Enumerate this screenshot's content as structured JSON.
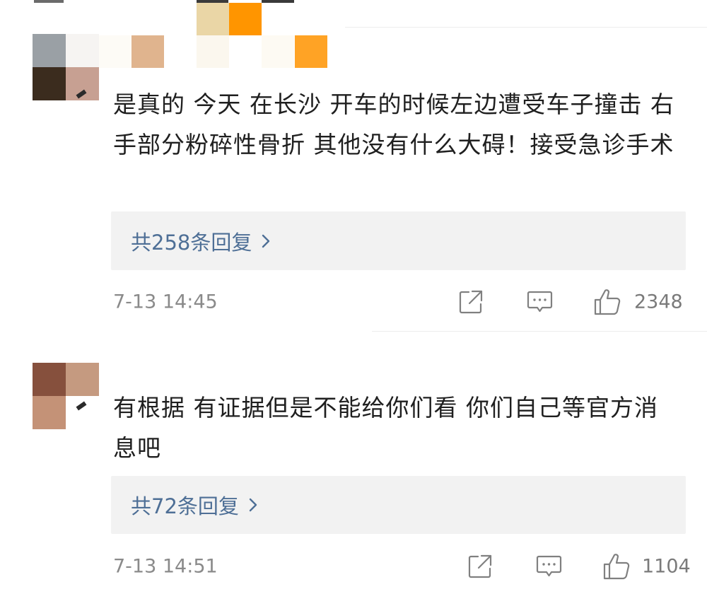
{
  "comments": [
    {
      "text": "是真的 今天 在长沙 开车的时候左边遭受车子撞击 右手部分粉碎性骨折 其他没有什么大碍！接受急诊手术",
      "replies_label": "共258条回复",
      "timestamp": "7-13 14:45",
      "likes": "2348",
      "icons": {
        "share": "share-icon",
        "comment": "comment-icon",
        "like": "thumbs-up-icon",
        "more": "chevron-right-icon"
      }
    },
    {
      "text": "有根据 有证据但是不能给你们看 你们自己等官方消息吧",
      "replies_label": "共72条回复",
      "timestamp": "7-13 14:51",
      "likes": "1104",
      "icons": {
        "share": "share-icon",
        "comment": "comment-icon",
        "like": "thumbs-up-icon",
        "more": "chevron-right-icon"
      }
    }
  ],
  "colors": {
    "reply_link": "#4e6f96",
    "reply_bg": "#f2f2f2",
    "meta_text": "#8a8a8a",
    "icon_stroke": "#808080"
  }
}
